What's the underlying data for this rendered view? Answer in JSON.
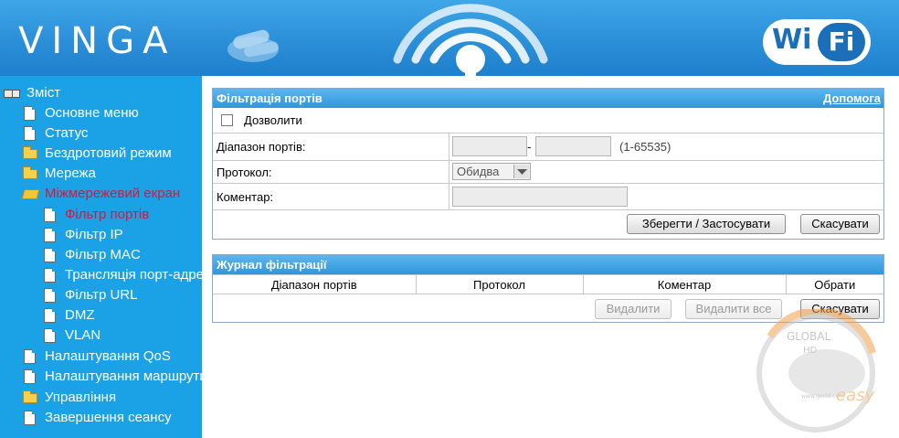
{
  "header": {
    "brand": "VINGA",
    "wifi_logo_left": "Wi",
    "wifi_logo_right": "Fi",
    "brand_color": "#2b8fd8"
  },
  "sidebar": {
    "title": "Зміст",
    "items": [
      {
        "label": "Основне меню",
        "icon": "document-icon"
      },
      {
        "label": "Статус",
        "icon": "document-icon"
      },
      {
        "label": "Бездротовий режим",
        "icon": "folder-icon"
      },
      {
        "label": "Мережа",
        "icon": "folder-icon"
      },
      {
        "label": "Міжмережевий екран",
        "icon": "folder-open-icon",
        "active": true
      },
      {
        "label": "Фільтр портів",
        "icon": "document-icon",
        "sub": true,
        "active": true
      },
      {
        "label": "Фільтр IP",
        "icon": "document-icon",
        "sub": true
      },
      {
        "label": "Фільтр MAC",
        "icon": "document-icon",
        "sub": true
      },
      {
        "label": "Трансляція порт-адрес",
        "icon": "document-icon",
        "sub": true
      },
      {
        "label": "Фільтр URL",
        "icon": "document-icon",
        "sub": true
      },
      {
        "label": "DMZ",
        "icon": "document-icon",
        "sub": true
      },
      {
        "label": "VLAN",
        "icon": "document-icon",
        "sub": true
      },
      {
        "label": "Налаштування QoS",
        "icon": "document-icon"
      },
      {
        "label": "Налаштування маршрутизації",
        "icon": "document-icon"
      },
      {
        "label": "Управління",
        "icon": "folder-icon"
      },
      {
        "label": "Завершення сеансу",
        "icon": "document-icon"
      }
    ],
    "active_color": "#d21a3a"
  },
  "filter_panel": {
    "title": "Фільтрація портів",
    "help": "Допомога",
    "enable_label": "Дозволити",
    "enable_checked": false,
    "port_range_label": "Діапазон портів:",
    "port_from": "",
    "port_separator": "-",
    "port_to": "",
    "port_hint": "(1-65535)",
    "protocol_label": "Протокол:",
    "protocol_value": "Обидва",
    "comment_label": "Коментар:",
    "comment_value": "",
    "save_label": "Зберегти / Застосувати",
    "cancel_label": "Скасувати"
  },
  "log_panel": {
    "title": "Журнал фільтрації",
    "columns": [
      "Діапазон портів",
      "Протокол",
      "Коментар",
      "Обрати"
    ],
    "delete_label": "Видалити",
    "delete_all_label": "Видалити все",
    "cancel_label": "Скасувати"
  },
  "watermark": {
    "top_text": "GLOBAL",
    "hd": "HD",
    "brand": "easy",
    "url": "www.gecid.com"
  }
}
